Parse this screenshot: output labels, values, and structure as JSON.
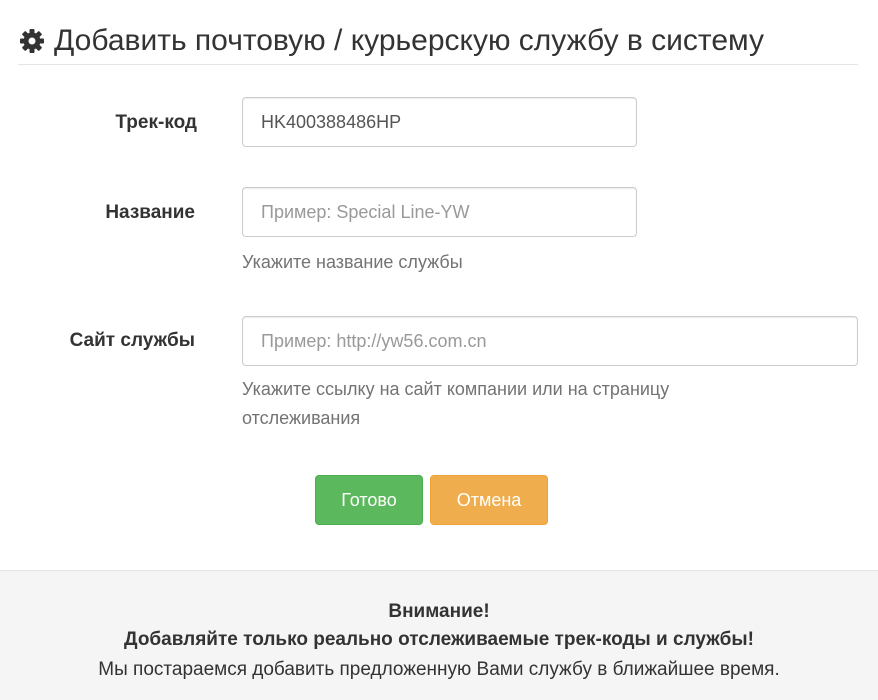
{
  "header": {
    "icon": "gear-icon",
    "title": "Добавить почтовую / курьерскую службу в систему"
  },
  "form": {
    "track_code": {
      "label": "Трек-код",
      "value": "HK400388486HP",
      "placeholder": ""
    },
    "name": {
      "label": "Название",
      "value": "",
      "placeholder": "Пример: Special Line-YW",
      "help": "Укажите название службы"
    },
    "site": {
      "label": "Сайт службы",
      "value": "",
      "placeholder": "Пример: http://yw56.com.cn",
      "help_line1": "Укажите ссылку на сайт компании или на страницу",
      "help_line2": "отслеживания"
    }
  },
  "buttons": {
    "submit_label": "Готово",
    "cancel_label": "Отмена"
  },
  "notice": {
    "title": "Внимание!",
    "bold_text": "Добавляйте только реально отслеживаемые трек-коды и службы!",
    "text": "Мы постараемся добавить предложенную Вами службу в ближайшее время."
  },
  "colors": {
    "success": "#5cb85c",
    "warning": "#f0ad4e",
    "notice_bg": "#f5f5f5"
  }
}
